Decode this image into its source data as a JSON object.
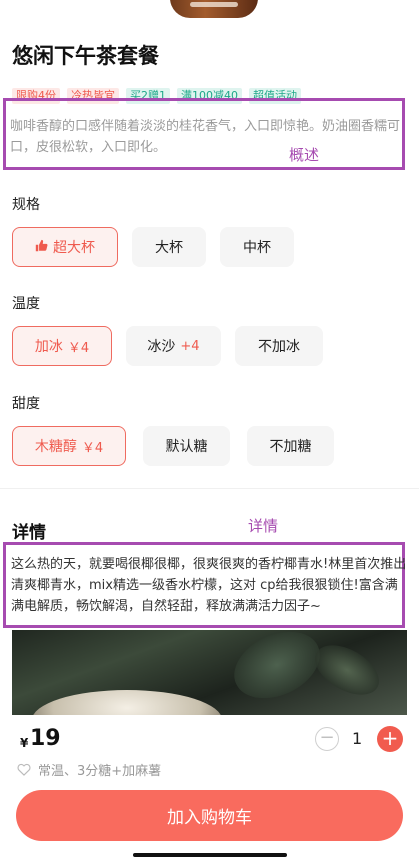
{
  "product": {
    "title": "悠闲下午茶套餐",
    "tags": [
      {
        "label": "限购4份",
        "tone": "red"
      },
      {
        "label": "冷热皆宜",
        "tone": "red"
      },
      {
        "label": "买2赠1",
        "tone": "teal"
      },
      {
        "label": "满100减40",
        "tone": "teal"
      },
      {
        "label": "超值活动",
        "tone": "teal"
      }
    ],
    "summary": "咖啡香醇的口感伴随着淡淡的桂花香气，入口即惊艳。奶油圈香糯可口，皮很松软，入口即化。",
    "summary_annotation": "概述"
  },
  "options": {
    "size": {
      "label": "规格",
      "choices": [
        {
          "label": "超大杯",
          "extra": ""
        },
        {
          "label": "大杯",
          "extra": ""
        },
        {
          "label": "中杯",
          "extra": ""
        }
      ]
    },
    "temperature": {
      "label": "温度",
      "choices": [
        {
          "label": "加冰",
          "extra": "￥4"
        },
        {
          "label": "冰沙",
          "extra": "+4"
        },
        {
          "label": "不加冰",
          "extra": ""
        }
      ]
    },
    "sweetness": {
      "label": "甜度",
      "choices": [
        {
          "label": "木糖醇",
          "extra": "￥4"
        },
        {
          "label": "默认糖",
          "extra": ""
        },
        {
          "label": "不加糖",
          "extra": ""
        }
      ]
    }
  },
  "details": {
    "title": "详情",
    "annotation": "详情",
    "text": "这么热的天，就要喝很椰很椰，很爽很爽的香柠椰青水!林里首次推出清爽椰青水，mix精选一级香水柠檬，这对 cp给我很狠锁住!富含满满电解质，畅饮解渴，自然轻甜，释放满满活力因子~"
  },
  "footer": {
    "currency": "¥",
    "price": "19",
    "quantity": "1",
    "minus": "−",
    "plus": "+",
    "selected_options": "常温、3分糖+加麻薯",
    "add_to_cart": "加入购物车"
  },
  "colors": {
    "accent": "#f15b4e",
    "annotation": "#a64bb0",
    "cart_button": "#f96b5e"
  }
}
